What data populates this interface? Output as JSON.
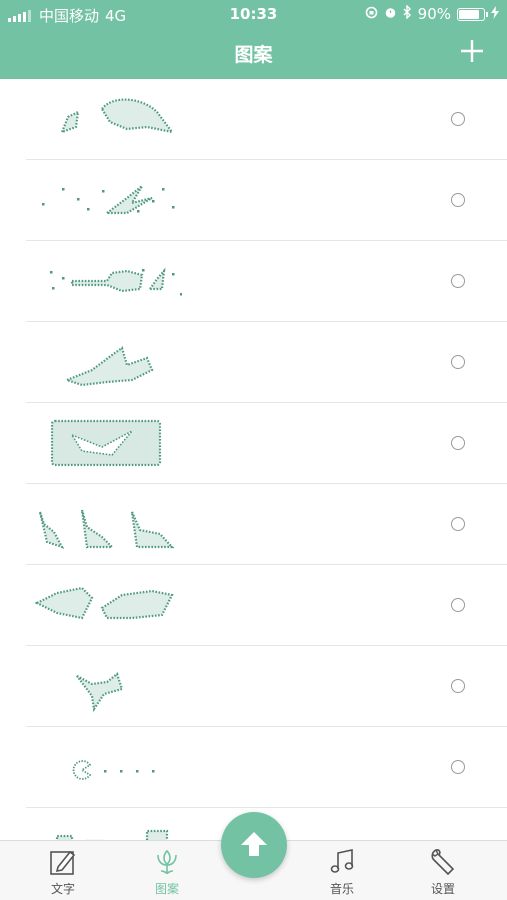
{
  "status": {
    "carrier": "中国移动",
    "network": "4G",
    "time": "10:33",
    "battery_pct": "90%",
    "battery_fill": 0.9
  },
  "header": {
    "title": "图案",
    "add_icon": "plus-icon"
  },
  "list": {
    "patterns": [
      {
        "icon": "dolphins-pattern"
      },
      {
        "icon": "airplane-pattern"
      },
      {
        "icon": "guitar-pattern"
      },
      {
        "icon": "plane-crash-pattern"
      },
      {
        "icon": "banner-pattern"
      },
      {
        "icon": "rabbits-pattern"
      },
      {
        "icon": "fish-pattern"
      },
      {
        "icon": "bird-pattern"
      },
      {
        "icon": "pacman-pattern"
      },
      {
        "icon": "city-pattern"
      }
    ]
  },
  "tabbar": {
    "tabs": [
      {
        "label": "文字",
        "icon": "edit-icon"
      },
      {
        "label": "图案",
        "icon": "flower-icon",
        "active": true
      },
      {
        "label": "音乐",
        "icon": "music-note-icon"
      },
      {
        "label": "设置",
        "icon": "wrench-icon"
      }
    ],
    "upload_icon": "arrow-up-icon"
  },
  "colors": {
    "accent": "#74c2a4",
    "pattern": "#4f9a7e"
  }
}
